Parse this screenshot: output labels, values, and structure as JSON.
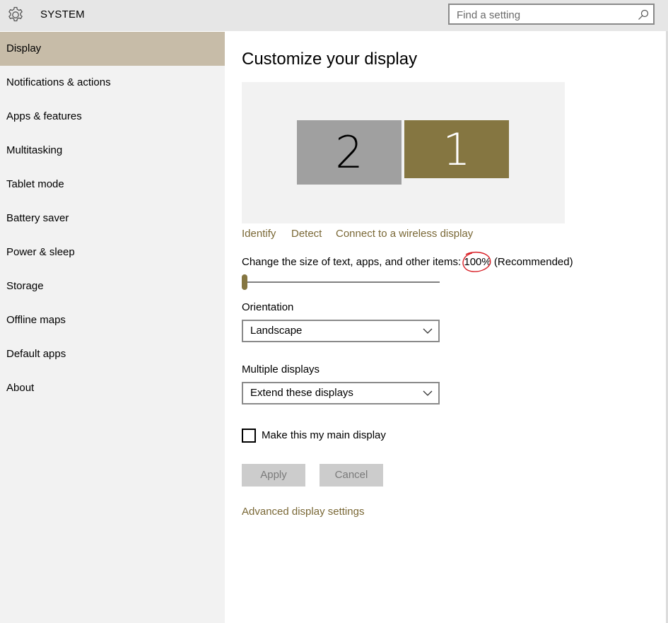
{
  "header": {
    "icon": "gear-icon",
    "title": "SYSTEM",
    "search_placeholder": "Find a setting",
    "search_icon": "search-icon"
  },
  "sidebar": {
    "items": [
      {
        "label": "Display",
        "active": true
      },
      {
        "label": "Notifications & actions"
      },
      {
        "label": "Apps & features"
      },
      {
        "label": "Multitasking"
      },
      {
        "label": "Tablet mode"
      },
      {
        "label": "Battery saver"
      },
      {
        "label": "Power & sleep"
      },
      {
        "label": "Storage"
      },
      {
        "label": "Offline maps"
      },
      {
        "label": "Default apps"
      },
      {
        "label": "About"
      }
    ]
  },
  "main": {
    "title": "Customize your display",
    "monitors": [
      {
        "number": "2",
        "selected": false
      },
      {
        "number": "1",
        "selected": true
      }
    ],
    "links": {
      "identify": "Identify",
      "detect": "Detect",
      "wireless": "Connect to a wireless display",
      "advanced": "Advanced display settings"
    },
    "scale": {
      "prefix": "Change the size of text, apps, and other items: ",
      "value": "100%",
      "suffix": " (Recommended)",
      "slider_fraction": 0
    },
    "orientation": {
      "label": "Orientation",
      "value": "Landscape"
    },
    "multiple_displays": {
      "label": "Multiple displays",
      "value": "Extend these displays"
    },
    "main_display_checkbox": {
      "label": "Make this my main display",
      "checked": false
    },
    "buttons": {
      "apply": "Apply",
      "cancel": "Cancel"
    }
  },
  "colors": {
    "accent": "#857641",
    "link": "#7a6836",
    "nav_active": "#c7bca8",
    "sidebar_bg": "#f2f2f2",
    "header_bg": "#e6e6e6",
    "annotation": "#d81f26"
  }
}
